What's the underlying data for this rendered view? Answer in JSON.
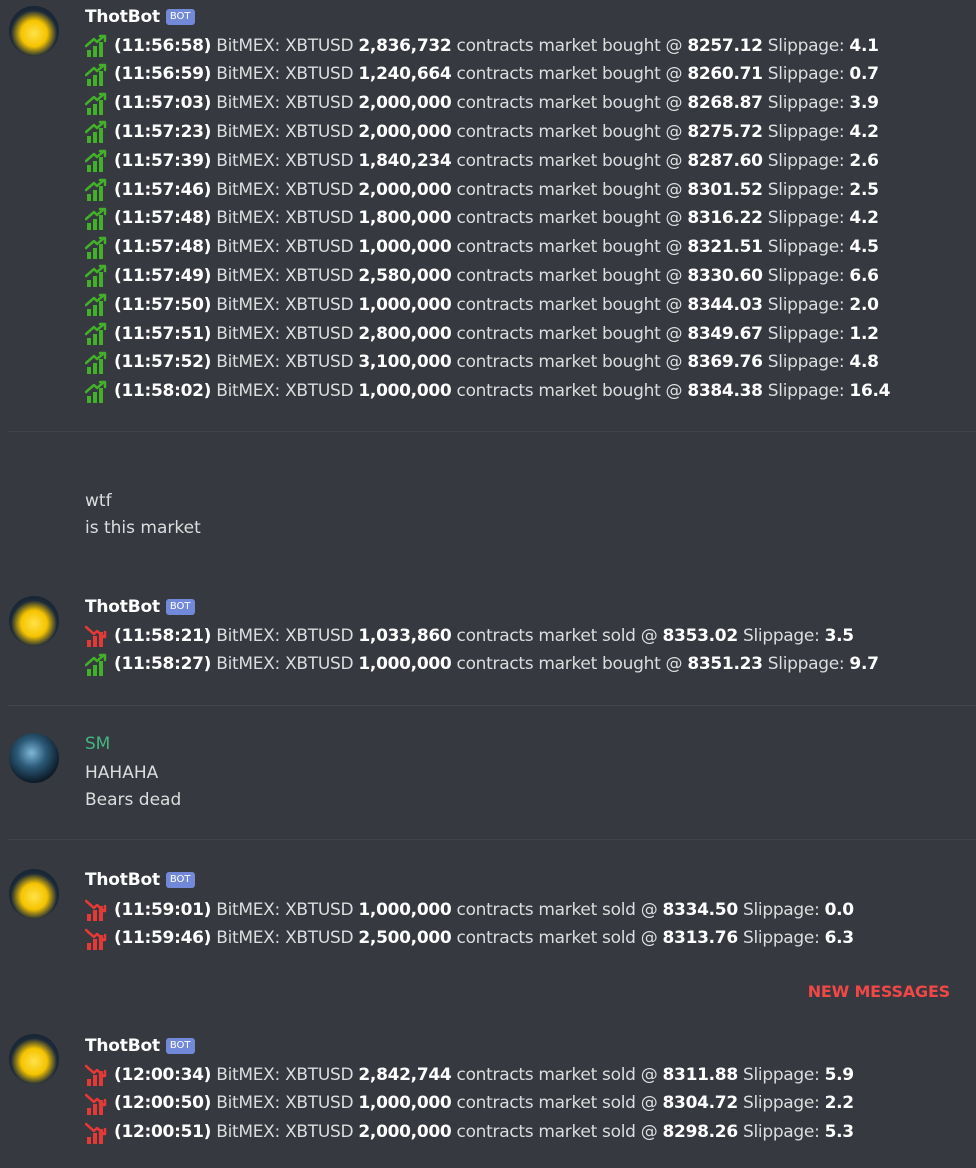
{
  "groups": {
    "g1": {
      "author": "ThotBot",
      "bot_tag": "BOT",
      "trades": [
        {
          "time": "(11:56:58)",
          "exchange": "BitMEX:",
          "symbol": "XBTUSD",
          "qty": "2,836,732",
          "action": "contracts market bought @",
          "price": "8257.12",
          "slip_label": "Slippage:",
          "slip": "4.1",
          "dir": "up"
        },
        {
          "time": "(11:56:59)",
          "exchange": "BitMEX:",
          "symbol": "XBTUSD",
          "qty": "1,240,664",
          "action": "contracts market bought @",
          "price": "8260.71",
          "slip_label": "Slippage:",
          "slip": "0.7",
          "dir": "up"
        },
        {
          "time": "(11:57:03)",
          "exchange": "BitMEX:",
          "symbol": "XBTUSD",
          "qty": "2,000,000",
          "action": "contracts market bought @",
          "price": "8268.87",
          "slip_label": "Slippage:",
          "slip": "3.9",
          "dir": "up"
        },
        {
          "time": "(11:57:23)",
          "exchange": "BitMEX:",
          "symbol": "XBTUSD",
          "qty": "2,000,000",
          "action": "contracts market bought @",
          "price": "8275.72",
          "slip_label": "Slippage:",
          "slip": "4.2",
          "dir": "up"
        },
        {
          "time": "(11:57:39)",
          "exchange": "BitMEX:",
          "symbol": "XBTUSD",
          "qty": "1,840,234",
          "action": "contracts market bought @",
          "price": "8287.60",
          "slip_label": "Slippage:",
          "slip": "2.6",
          "dir": "up"
        },
        {
          "time": "(11:57:46)",
          "exchange": "BitMEX:",
          "symbol": "XBTUSD",
          "qty": "2,000,000",
          "action": "contracts market bought @",
          "price": "8301.52",
          "slip_label": "Slippage:",
          "slip": "2.5",
          "dir": "up"
        },
        {
          "time": "(11:57:48)",
          "exchange": "BitMEX:",
          "symbol": "XBTUSD",
          "qty": "1,800,000",
          "action": "contracts market bought @",
          "price": "8316.22",
          "slip_label": "Slippage:",
          "slip": "4.2",
          "dir": "up"
        },
        {
          "time": "(11:57:48)",
          "exchange": "BitMEX:",
          "symbol": "XBTUSD",
          "qty": "1,000,000",
          "action": "contracts market bought @",
          "price": "8321.51",
          "slip_label": "Slippage:",
          "slip": "4.5",
          "dir": "up"
        },
        {
          "time": "(11:57:49)",
          "exchange": "BitMEX:",
          "symbol": "XBTUSD",
          "qty": "2,580,000",
          "action": "contracts market bought @",
          "price": "8330.60",
          "slip_label": "Slippage:",
          "slip": "6.6",
          "dir": "up"
        },
        {
          "time": "(11:57:50)",
          "exchange": "BitMEX:",
          "symbol": "XBTUSD",
          "qty": "1,000,000",
          "action": "contracts market bought @",
          "price": "8344.03",
          "slip_label": "Slippage:",
          "slip": "2.0",
          "dir": "up"
        },
        {
          "time": "(11:57:51)",
          "exchange": "BitMEX:",
          "symbol": "XBTUSD",
          "qty": "2,800,000",
          "action": "contracts market bought @",
          "price": "8349.67",
          "slip_label": "Slippage:",
          "slip": "1.2",
          "dir": "up"
        },
        {
          "time": "(11:57:52)",
          "exchange": "BitMEX:",
          "symbol": "XBTUSD",
          "qty": "3,100,000",
          "action": "contracts market bought @",
          "price": "8369.76",
          "slip_label": "Slippage:",
          "slip": "4.8",
          "dir": "up"
        },
        {
          "time": "(11:58:02)",
          "exchange": "BitMEX:",
          "symbol": "XBTUSD",
          "qty": "1,000,000",
          "action": "contracts market bought @",
          "price": "8384.38",
          "slip_label": "Slippage:",
          "slip": "16.4",
          "dir": "up"
        }
      ]
    },
    "g2": {
      "lines": [
        "wtf",
        "is this market"
      ]
    },
    "g3": {
      "author": "ThotBot",
      "bot_tag": "BOT",
      "trades": [
        {
          "time": "(11:58:21)",
          "exchange": "BitMEX:",
          "symbol": "XBTUSD",
          "qty": "1,033,860",
          "action": "contracts market sold @",
          "price": "8353.02",
          "slip_label": "Slippage:",
          "slip": "3.5",
          "dir": "down"
        },
        {
          "time": "(11:58:27)",
          "exchange": "BitMEX:",
          "symbol": "XBTUSD",
          "qty": "1,000,000",
          "action": "contracts market bought @",
          "price": "8351.23",
          "slip_label": "Slippage:",
          "slip": "9.7",
          "dir": "up"
        }
      ]
    },
    "g4": {
      "author": "SM",
      "lines": [
        "HAHAHA",
        "Bears dead"
      ]
    },
    "g5": {
      "author": "ThotBot",
      "bot_tag": "BOT",
      "trades": [
        {
          "time": "(11:59:01)",
          "exchange": "BitMEX:",
          "symbol": "XBTUSD",
          "qty": "1,000,000",
          "action": "contracts market sold @",
          "price": "8334.50",
          "slip_label": "Slippage:",
          "slip": "0.0",
          "dir": "down"
        },
        {
          "time": "(11:59:46)",
          "exchange": "BitMEX:",
          "symbol": "XBTUSD",
          "qty": "2,500,000",
          "action": "contracts market sold @",
          "price": "8313.76",
          "slip_label": "Slippage:",
          "slip": "6.3",
          "dir": "down"
        }
      ]
    },
    "g6": {
      "author": "ThotBot",
      "bot_tag": "BOT",
      "trades": [
        {
          "time": "(12:00:34)",
          "exchange": "BitMEX:",
          "symbol": "XBTUSD",
          "qty": "2,842,744",
          "action": "contracts market sold @",
          "price": "8311.88",
          "slip_label": "Slippage:",
          "slip": "5.9",
          "dir": "down"
        },
        {
          "time": "(12:00:50)",
          "exchange": "BitMEX:",
          "symbol": "XBTUSD",
          "qty": "1,000,000",
          "action": "contracts market sold @",
          "price": "8304.72",
          "slip_label": "Slippage:",
          "slip": "2.2",
          "dir": "down"
        },
        {
          "time": "(12:00:51)",
          "exchange": "BitMEX:",
          "symbol": "XBTUSD",
          "qty": "2,000,000",
          "action": "contracts market sold @",
          "price": "8298.26",
          "slip_label": "Slippage:",
          "slip": "5.3",
          "dir": "down"
        }
      ]
    }
  },
  "new_messages_label": "NEW MESSAGES",
  "colors": {
    "up": "#43b02a",
    "down": "#e53935",
    "new_messages": "#f04747",
    "bot_tag": "#7289da"
  }
}
